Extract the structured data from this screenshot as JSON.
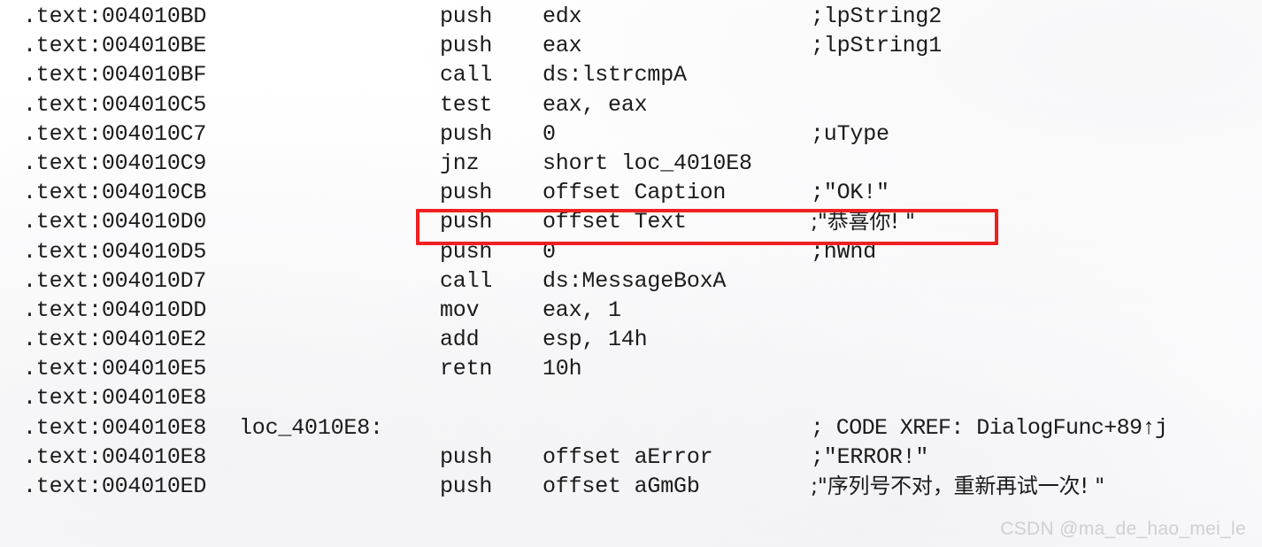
{
  "document": {
    "kind": "disassembly-listing",
    "segment": ".text"
  },
  "highlight": {
    "color": "#f02020",
    "target_address": ".text:004010D0"
  },
  "lines": [
    {
      "address": ".text:004010BD",
      "label": "",
      "mnemonic": "push",
      "operands": "edx",
      "comment": ";lpString2"
    },
    {
      "address": ".text:004010BE",
      "label": "",
      "mnemonic": "push",
      "operands": "eax",
      "comment": ";lpString1"
    },
    {
      "address": ".text:004010BF",
      "label": "",
      "mnemonic": "call",
      "operands": "ds:lstrcmpA",
      "comment": ""
    },
    {
      "address": ".text:004010C5",
      "label": "",
      "mnemonic": "test",
      "operands": "eax, eax",
      "comment": ""
    },
    {
      "address": ".text:004010C7",
      "label": "",
      "mnemonic": "push",
      "operands": "0",
      "comment": ";uType"
    },
    {
      "address": ".text:004010C9",
      "label": "",
      "mnemonic": "jnz",
      "operands": "short loc_4010E8",
      "comment": ""
    },
    {
      "address": ".text:004010CB",
      "label": "",
      "mnemonic": "push",
      "operands": "offset Caption",
      "comment": ";\"OK!\""
    },
    {
      "address": ".text:004010D0",
      "label": "",
      "mnemonic": "push",
      "operands": "offset Text",
      "comment": ";\"恭喜你! \""
    },
    {
      "address": ".text:004010D5",
      "label": "",
      "mnemonic": "push",
      "operands": "0",
      "comment": ";hWnd"
    },
    {
      "address": ".text:004010D7",
      "label": "",
      "mnemonic": "call",
      "operands": "ds:MessageBoxA",
      "comment": ""
    },
    {
      "address": ".text:004010DD",
      "label": "",
      "mnemonic": "mov",
      "operands": "eax, 1",
      "comment": ""
    },
    {
      "address": ".text:004010E2",
      "label": "",
      "mnemonic": "add",
      "operands": "esp, 14h",
      "comment": ""
    },
    {
      "address": ".text:004010E5",
      "label": "",
      "mnemonic": "retn",
      "operands": "10h",
      "comment": ""
    },
    {
      "address": ".text:004010E8",
      "label": "",
      "mnemonic": "",
      "operands": "",
      "comment": ""
    },
    {
      "address": ".text:004010E8",
      "label": "loc_4010E8:",
      "mnemonic": "",
      "operands": "",
      "comment": "; CODE XREF: DialogFunc+89↑j"
    },
    {
      "address": ".text:004010E8",
      "label": "",
      "mnemonic": "push",
      "operands": "offset aError",
      "comment": ";\"ERROR!\""
    },
    {
      "address": ".text:004010ED",
      "label": "",
      "mnemonic": "push",
      "operands": "offset aGmGb",
      "comment": ";\"序列号不对，重新再试一次! \""
    }
  ],
  "watermark": {
    "text": "CSDN @ma_de_hao_mei_le"
  }
}
